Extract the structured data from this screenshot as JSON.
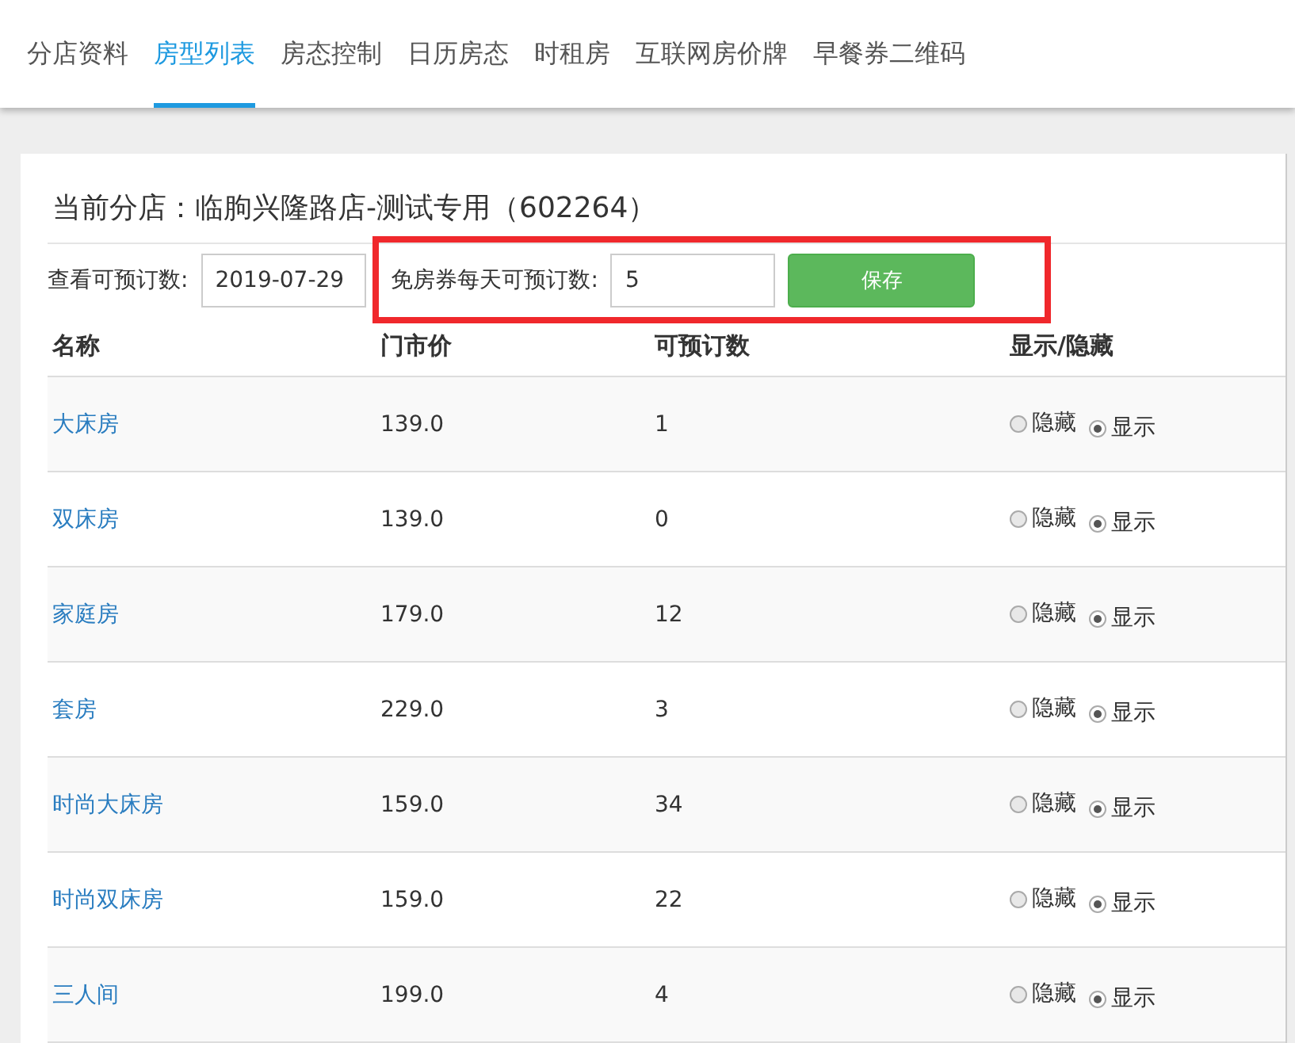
{
  "tabs": [
    {
      "label": "分店资料",
      "selected": false
    },
    {
      "label": "房型列表",
      "selected": true
    },
    {
      "label": "房态控制",
      "selected": false
    },
    {
      "label": "日历房态",
      "selected": false
    },
    {
      "label": "时租房",
      "selected": false
    },
    {
      "label": "互联网房价牌",
      "selected": false
    },
    {
      "label": "早餐券二维码",
      "selected": false
    }
  ],
  "store_title": "当前分店：临朐兴隆路店-测试专用（602264）",
  "filters": {
    "date_label": "查看可预订数:",
    "date_value": "2019-07-29",
    "quota_label": "免房券每天可预订数:",
    "quota_value": "5",
    "save_button": "保存",
    "highlighted": true
  },
  "table": {
    "columns": [
      "名称",
      "门市价",
      "可预订数",
      "显示/隐藏"
    ],
    "rows": [
      {
        "name": "大床房",
        "price": "139.0",
        "available": "1",
        "options": [
          {
            "label": "隐藏",
            "selected": false
          },
          {
            "label": "显示",
            "selected": true
          }
        ]
      },
      {
        "name": "双床房",
        "price": "139.0",
        "available": "0",
        "options": [
          {
            "label": "隐藏",
            "selected": false
          },
          {
            "label": "显示",
            "selected": true
          }
        ]
      },
      {
        "name": "家庭房",
        "price": "179.0",
        "available": "12",
        "options": [
          {
            "label": "隐藏",
            "selected": false
          },
          {
            "label": "显示",
            "selected": true
          }
        ]
      },
      {
        "name": "套房",
        "price": "229.0",
        "available": "3",
        "options": [
          {
            "label": "隐藏",
            "selected": false
          },
          {
            "label": "显示",
            "selected": true
          }
        ]
      },
      {
        "name": "时尚大床房",
        "price": "159.0",
        "available": "34",
        "options": [
          {
            "label": "隐藏",
            "selected": false
          },
          {
            "label": "显示",
            "selected": true
          }
        ]
      },
      {
        "name": "时尚双床房",
        "price": "159.0",
        "available": "22",
        "options": [
          {
            "label": "隐藏",
            "selected": false
          },
          {
            "label": "显示",
            "selected": true
          }
        ]
      },
      {
        "name": "三人间",
        "price": "199.0",
        "available": "4",
        "options": [
          {
            "label": "隐藏",
            "selected": false
          },
          {
            "label": "显示",
            "selected": true
          }
        ]
      }
    ]
  }
}
